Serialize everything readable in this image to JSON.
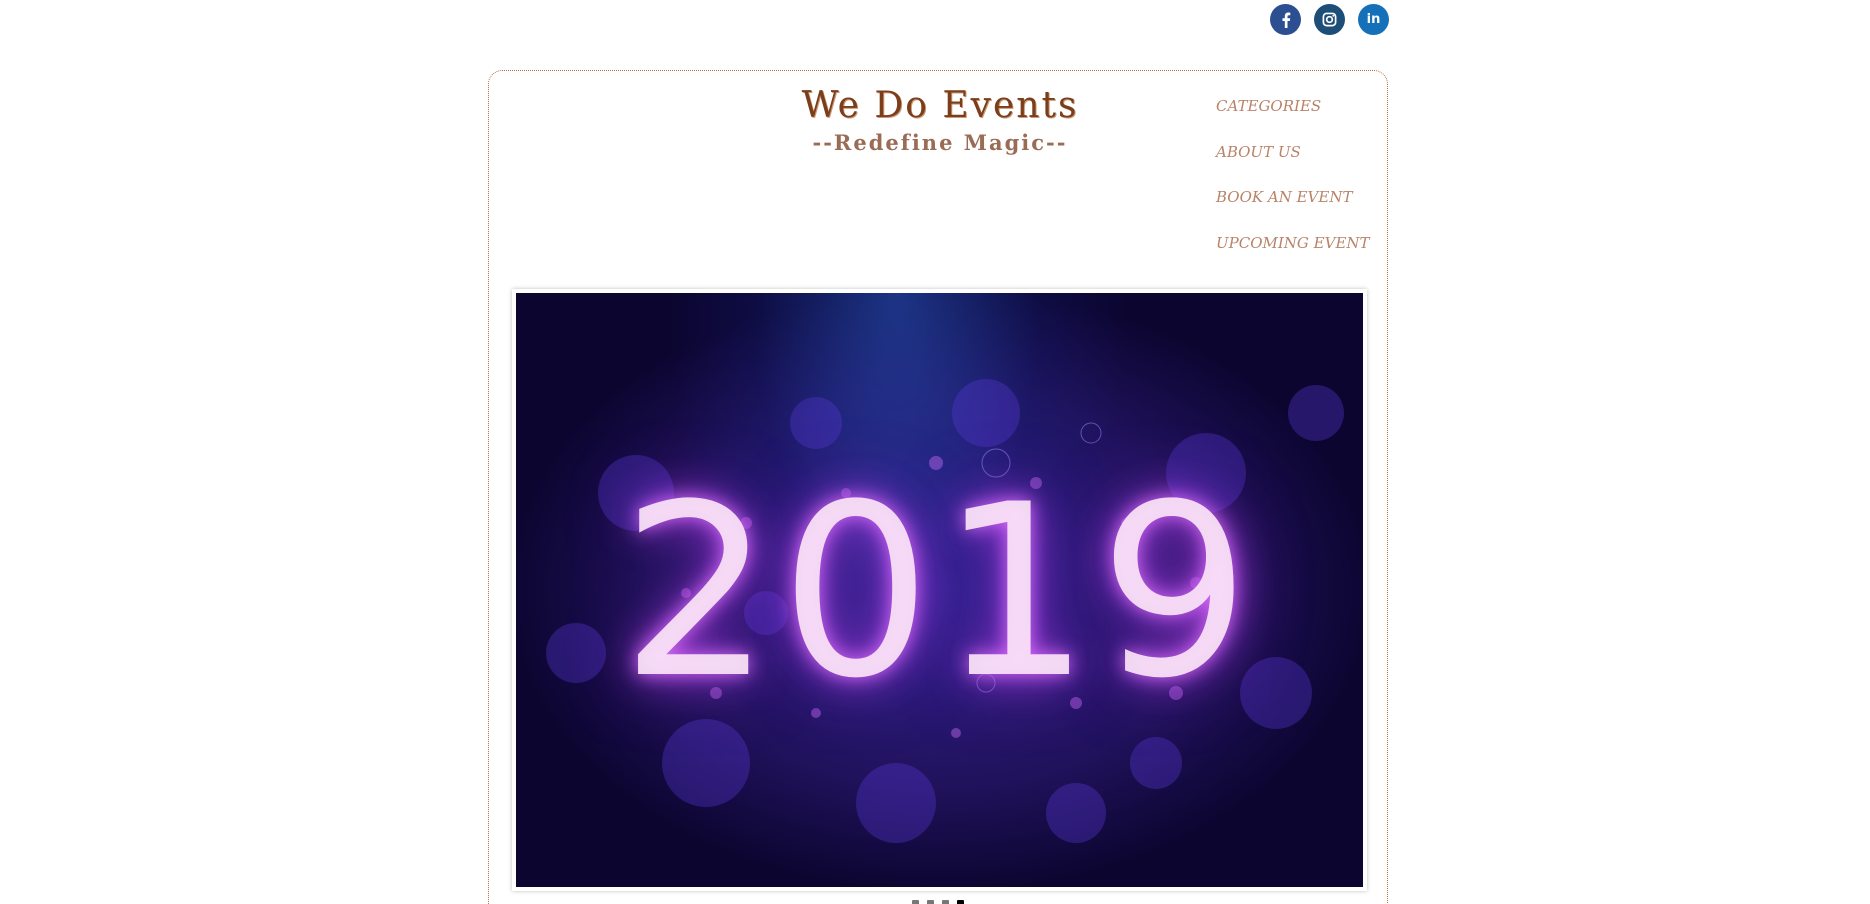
{
  "social": {
    "facebook_icon": "facebook-icon",
    "instagram_icon": "instagram-icon",
    "linkedin_icon": "linkedin-icon",
    "linkedin_label": "in"
  },
  "brand": {
    "title": "We Do Events",
    "subtitle": "--Redefine Magic--",
    "title_color": "#7c3e1a",
    "subtitle_color": "#9a6c55"
  },
  "nav": {
    "items": [
      {
        "label": "CATEGORIES"
      },
      {
        "label": "ABOUT US"
      },
      {
        "label": "BOOK AN EVENT"
      },
      {
        "label": "UPCOMING EVENT"
      }
    ],
    "color": "#b88368"
  },
  "slideshow": {
    "slide_text": "2019",
    "slide_count": 4,
    "active_index": 3
  },
  "colors": {
    "frame_border": "#b56e3c",
    "facebook": "#2c4f91",
    "instagram": "#1d4e78",
    "linkedin": "#1470b8"
  }
}
